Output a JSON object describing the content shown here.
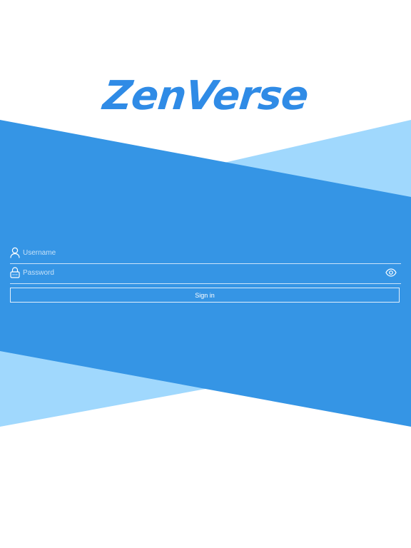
{
  "app": {
    "brand_name": "ZenVerse"
  },
  "login_form": {
    "username_placeholder": "Username",
    "password_placeholder": "Password",
    "username_icon": "user-icon",
    "password_icon": "lock-icon",
    "reveal_password_icon": "eye-icon",
    "sign_in_label": "Sign in"
  },
  "colors": {
    "brand_blue": "#2f8be6",
    "background_blue": "#3595e5",
    "light_blue": "#a0d8fd",
    "page_background": "#ffffff",
    "foreground": "#ffffff"
  }
}
